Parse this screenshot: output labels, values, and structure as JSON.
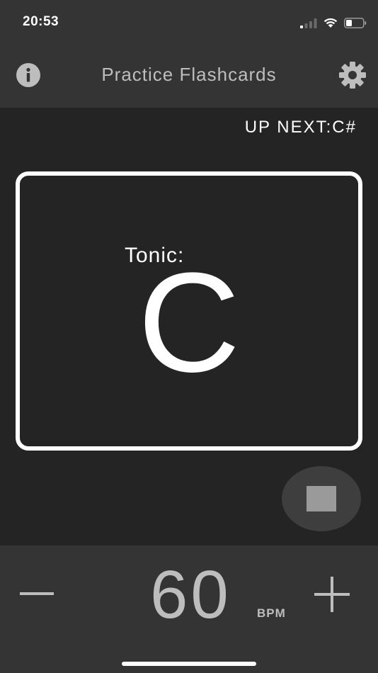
{
  "status_bar": {
    "time": "20:53",
    "icons": [
      "cellular-signal-icon",
      "wifi-icon",
      "battery-icon"
    ]
  },
  "nav": {
    "title": "Practice Flashcards",
    "info_icon": "info-icon",
    "settings_icon": "gear-icon"
  },
  "up_next": {
    "text": "UP NEXT:C#"
  },
  "card": {
    "label": "Tonic:",
    "note": "C"
  },
  "controls": {
    "stop_icon": "stop-icon"
  },
  "tempo": {
    "value": "60",
    "unit": "BPM",
    "decrease_icon": "minus-icon",
    "increase_icon": "plus-icon"
  },
  "colors": {
    "background": "#242424",
    "bars": "#343434",
    "text_primary": "#ffffff",
    "text_secondary": "#bdbdbd",
    "stop_button_bg": "#3e3e3e",
    "stop_square": "#9a9a9a"
  }
}
